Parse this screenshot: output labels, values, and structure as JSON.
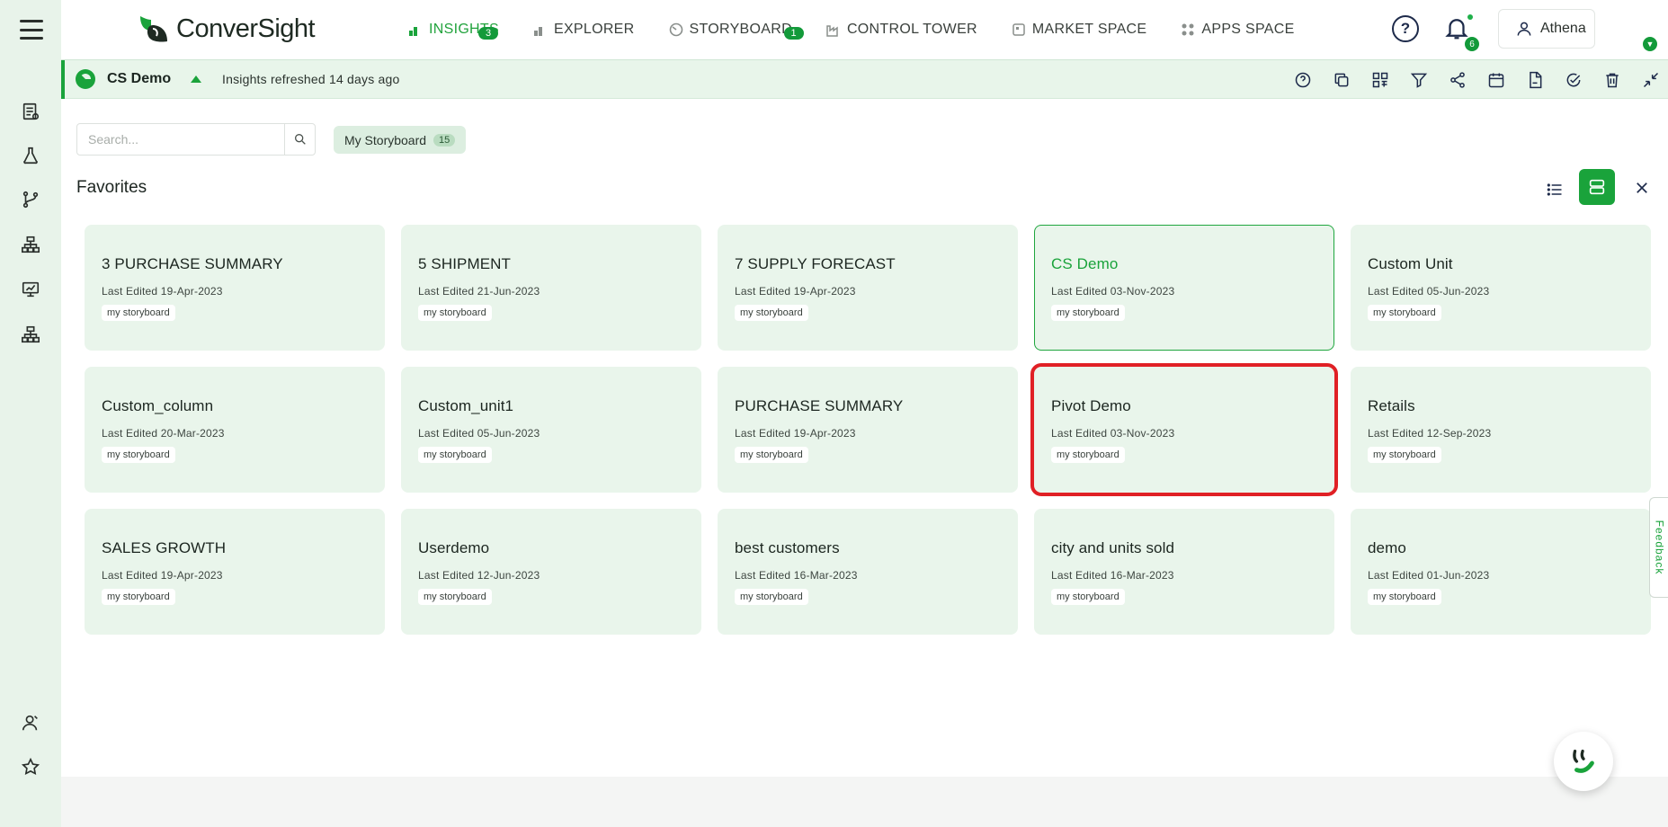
{
  "app": {
    "name": "ConverSight"
  },
  "nav": {
    "items": [
      {
        "label": "INSIGHTS",
        "badge": "3",
        "active": true
      },
      {
        "label": "EXPLORER",
        "badge": "",
        "active": false
      },
      {
        "label": "STORYBOARD",
        "badge": "1",
        "active": false
      },
      {
        "label": "CONTROL TOWER",
        "badge": "",
        "active": false
      },
      {
        "label": "MARKET SPACE",
        "badge": "",
        "active": false
      },
      {
        "label": "APPS SPACE",
        "badge": "",
        "active": false
      }
    ]
  },
  "header": {
    "help": "?",
    "notifications_count": "6",
    "user_name": "Athena"
  },
  "context": {
    "title": "CS Demo",
    "refreshed": "Insights refreshed 14 days ago"
  },
  "toolbar": {
    "icons": [
      "help-icon",
      "duplicate-icon",
      "grid-layout-icon",
      "filter-icon",
      "share-icon",
      "calendar-icon",
      "pdf-icon",
      "check-icon",
      "trash-icon",
      "collapse-icon"
    ]
  },
  "search": {
    "placeholder": "Search..."
  },
  "filter_tag": {
    "label": "My Storyboard",
    "count": "15"
  },
  "favorites": {
    "title": "Favorites",
    "cards": [
      {
        "title": "3 PURCHASE SUMMARY",
        "date": "Last Edited 19-Apr-2023",
        "tag": "my storyboard"
      },
      {
        "title": "5 SHIPMENT",
        "date": "Last Edited 21-Jun-2023",
        "tag": "my storyboard"
      },
      {
        "title": "7 SUPPLY FORECAST",
        "date": "Last Edited 19-Apr-2023",
        "tag": "my storyboard"
      },
      {
        "title": "CS Demo",
        "date": "Last Edited 03-Nov-2023",
        "tag": "my storyboard"
      },
      {
        "title": "Custom Unit",
        "date": "Last Edited 05-Jun-2023",
        "tag": "my storyboard"
      },
      {
        "title": "Custom_column",
        "date": "Last Edited 20-Mar-2023",
        "tag": "my storyboard"
      },
      {
        "title": "Custom_unit1",
        "date": "Last Edited 05-Jun-2023",
        "tag": "my storyboard"
      },
      {
        "title": "PURCHASE SUMMARY",
        "date": "Last Edited 19-Apr-2023",
        "tag": "my storyboard"
      },
      {
        "title": "Pivot Demo",
        "date": "Last Edited 03-Nov-2023",
        "tag": "my storyboard"
      },
      {
        "title": "Retails",
        "date": "Last Edited 12-Sep-2023",
        "tag": "my storyboard"
      },
      {
        "title": "SALES GROWTH",
        "date": "Last Edited 19-Apr-2023",
        "tag": "my storyboard"
      },
      {
        "title": "Userdemo",
        "date": "Last Edited 12-Jun-2023",
        "tag": "my storyboard"
      },
      {
        "title": "best customers",
        "date": "Last Edited 16-Mar-2023",
        "tag": "my storyboard"
      },
      {
        "title": "city and units sold",
        "date": "Last Edited 16-Mar-2023",
        "tag": "my storyboard"
      },
      {
        "title": "demo",
        "date": "Last Edited 01-Jun-2023",
        "tag": "my storyboard"
      }
    ]
  },
  "feedback": {
    "label": "Feedback"
  },
  "colors": {
    "accent": "#1aa33b",
    "card_bg": "#e9f5eb",
    "highlight": "#e02025"
  }
}
